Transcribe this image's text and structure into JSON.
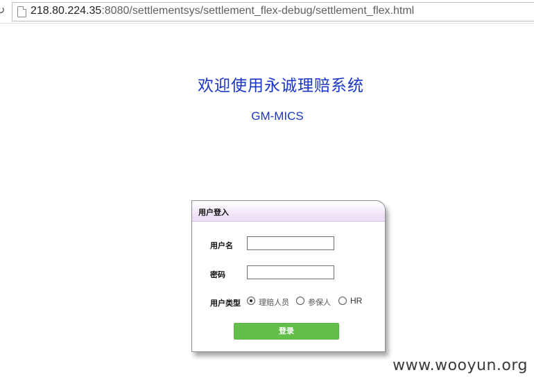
{
  "browser": {
    "url_host": "218.80.224.35",
    "url_rest": ":8080/settlementsys/settlement_flex-debug/settlement_flex.html"
  },
  "header": {
    "title": "欢迎使用永诚理赔系统",
    "subtitle": "GM-MICS"
  },
  "login_panel": {
    "title": "用户登入",
    "username_label": "用户名",
    "username_value": "",
    "password_label": "密码",
    "password_value": "",
    "user_type_label": "用户类型",
    "user_types": [
      {
        "label": "理赔人员",
        "checked": true
      },
      {
        "label": "参保人",
        "checked": false
      },
      {
        "label": "HR",
        "checked": false
      }
    ],
    "login_button": "登录"
  },
  "watermark": "www.wooyun.org",
  "colors": {
    "heading": "#1a35c8",
    "button": "#63bf4a",
    "panel_header": "#eadcf6"
  },
  "icons": [
    "reload-icon",
    "page-icon"
  ]
}
